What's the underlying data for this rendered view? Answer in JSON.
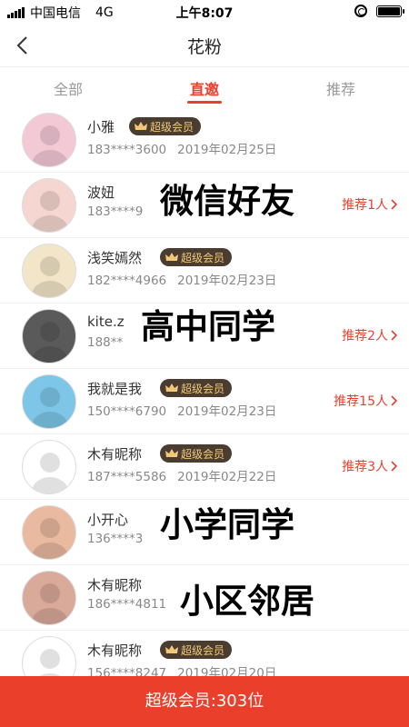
{
  "status_bar": {
    "carrier": "中国电信",
    "network": "4G",
    "time": "上午8:07",
    "battery_level": 1.0
  },
  "nav": {
    "title": "花粉"
  },
  "tabs": [
    {
      "label": "全部",
      "active": false
    },
    {
      "label": "直邀",
      "active": true
    },
    {
      "label": "推荐",
      "active": false
    }
  ],
  "rows": [
    {
      "name": "小雅",
      "badge": "超级会员",
      "phone": "183****3600",
      "date": "2019年02月25日",
      "recommend": "",
      "avatar_color": "#f4c9d6"
    },
    {
      "name": "波妞",
      "badge": "",
      "phone": "183****9",
      "date": "",
      "recommend": "推荐1人",
      "avatar_color": "#f6d6d0"
    },
    {
      "name": "浅笑嫣然",
      "badge": "超级会员",
      "phone": "182****4966",
      "date": "2019年02月23日",
      "recommend": "",
      "avatar_color": "#f3e6c8"
    },
    {
      "name": "kite.z",
      "badge": "",
      "phone": "188**",
      "date": "",
      "recommend": "推荐2人",
      "avatar_color": "#5a5a5a"
    },
    {
      "name": "我就是我",
      "badge": "超级会员",
      "phone": "150****6790",
      "date": "2019年02月23日",
      "recommend": "推荐15人",
      "avatar_color": "#7dc6e8"
    },
    {
      "name": "木有昵称",
      "badge": "超级会员",
      "phone": "187****5586",
      "date": "2019年02月22日",
      "recommend": "推荐3人",
      "avatar_color": "#ffffff"
    },
    {
      "name": "小开心",
      "badge": "",
      "phone": "136****3",
      "date": "",
      "recommend": "",
      "avatar_color": "#e9b9a0"
    },
    {
      "name": "木有昵称",
      "badge": "",
      "phone": "186****4811",
      "date": "",
      "recommend": "",
      "avatar_color": "#d9a999"
    },
    {
      "name": "木有昵称",
      "badge": "超级会员",
      "phone": "156****8247",
      "date": "2019年02月20日",
      "recommend": "",
      "avatar_color": "#ffffff"
    }
  ],
  "overlays": {
    "wechat_friends": "微信好友",
    "high_school_classmates": "高中同学",
    "primary_school_classmates": "小学同学",
    "neighborhood_neighbors": "小区邻居"
  },
  "footer": {
    "label": "超级会员:303位"
  },
  "colors": {
    "accent": "#e8402f",
    "footer_bg": "#ea3f2a",
    "badge_bg": "#4a3d30",
    "badge_text": "#f2c77a"
  }
}
